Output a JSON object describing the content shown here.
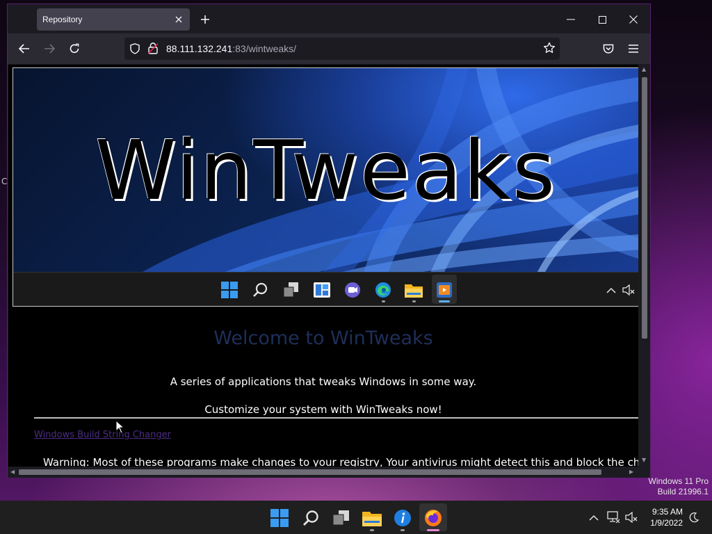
{
  "browser": {
    "tab": {
      "title": "Repository"
    },
    "url": {
      "host": "88.111.132.241",
      "rest": ":83/wintweaks/"
    }
  },
  "page": {
    "banner_title": "WinTweaks",
    "welcome": "Welcome to WinTweaks",
    "intro": "A series of applications that tweaks Windows in some way.",
    "cta": "Customize your system with WinTweaks now!",
    "link": "Windows Build String Changer",
    "warning": "Warning: Most of these programs make changes to your registry, Your antivirus might detect this and block the changes"
  },
  "desktop": {
    "edge_glyph": "C",
    "watermark": {
      "line1": "Windows 11 Pro",
      "line2": "Build 21996.1"
    }
  },
  "taskbar": {
    "clock": {
      "time": "9:35 AM",
      "date": "1/9/2022"
    },
    "pins": [
      "start-icon",
      "search-icon",
      "task-view-icon",
      "file-explorer-icon",
      "info-app-icon",
      "firefox-icon"
    ]
  },
  "colors": {
    "accent_blue": "#3a7bd5",
    "welcome_text": "#1f2f5a",
    "link_text": "#4b2d82",
    "window_border": "#5b1f6e"
  }
}
